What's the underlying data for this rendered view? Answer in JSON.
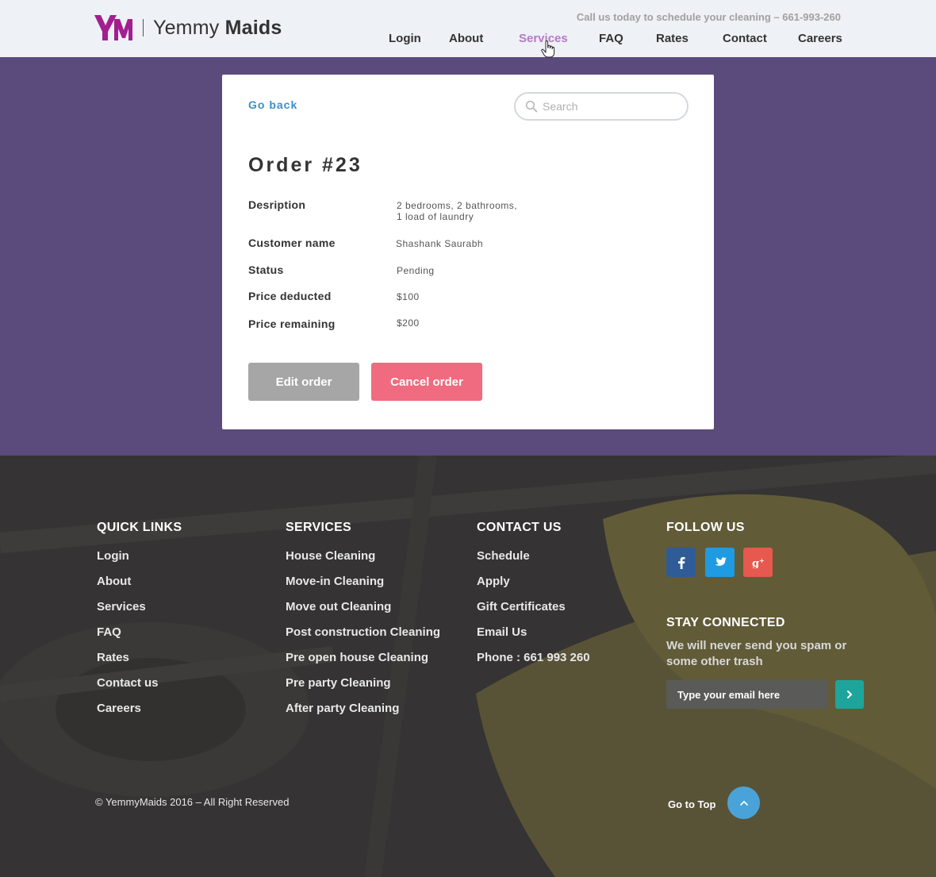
{
  "brand": {
    "name_light": "Yemmy",
    "name_bold": "Maids",
    "accent": "#a21f8f"
  },
  "header": {
    "callus": "Call us today to schedule your cleaning – 661-993-260",
    "nav": [
      "Login",
      "About",
      "Services",
      "FAQ",
      "Rates",
      "Contact",
      "Careers"
    ],
    "active_nav": "Services"
  },
  "card": {
    "goback": "Go back",
    "search_placeholder": "Search",
    "title": "Order #23",
    "rows": [
      {
        "label": "Desription",
        "value_line1": "2 bedrooms, 2 bathrooms,",
        "value_line2": "1 load of laundry"
      },
      {
        "label": "Customer name",
        "value": "Shashank Saurabh"
      },
      {
        "label": "Status",
        "value": "Pending"
      },
      {
        "label": "Price deducted",
        "value": "$100"
      },
      {
        "label": "Price remaining",
        "value": "$200"
      }
    ],
    "edit_label": "Edit order",
    "cancel_label": "Cancel order"
  },
  "footer": {
    "quick_links": {
      "heading": "QUICK LINKS",
      "items": [
        "Login",
        "About",
        "Services",
        "FAQ",
        "Rates",
        "Contact us",
        "Careers"
      ]
    },
    "services": {
      "heading": "SERVICES",
      "items": [
        "House Cleaning",
        "Move-in Cleaning",
        "Move out Cleaning",
        "Post construction Cleaning",
        "Pre open house Cleaning",
        "Pre party Cleaning",
        "After party Cleaning"
      ]
    },
    "contact": {
      "heading": "CONTACT US",
      "items": [
        "Schedule",
        "Apply",
        "Gift Certificates",
        "Email Us",
        "Phone : 661 993 260"
      ]
    },
    "follow": {
      "heading": "FOLLOW US",
      "icons": [
        "facebook-icon",
        "twitter-icon",
        "google-plus-icon"
      ]
    },
    "stay": {
      "heading": "STAY CONNECTED",
      "text": "We will never send you spam or some other trash",
      "email_placeholder": "Type your email here"
    },
    "copyright": "© YemmyMaids 2016 – All Right Reserved",
    "gototop": "Go to Top"
  }
}
